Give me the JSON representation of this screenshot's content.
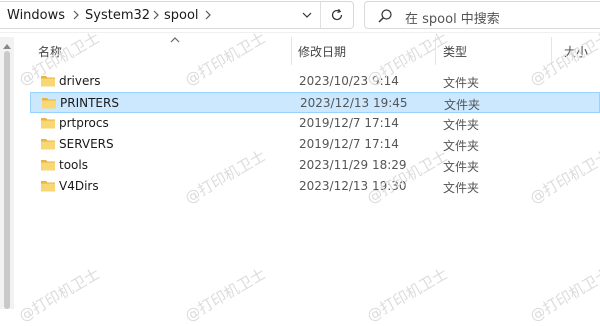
{
  "address_bar": {
    "crumbs": [
      "Windows",
      "System32",
      "spool"
    ]
  },
  "search": {
    "placeholder": "在 spool 中搜索"
  },
  "columns": {
    "name": "名称",
    "date": "修改日期",
    "type": "类型",
    "size": "大小"
  },
  "files": [
    {
      "name": "drivers",
      "date": "2023/10/23 9:14",
      "type": "文件夹",
      "selected": false
    },
    {
      "name": "PRINTERS",
      "date": "2023/12/13 19:45",
      "type": "文件夹",
      "selected": true
    },
    {
      "name": "prtprocs",
      "date": "2019/12/7 17:14",
      "type": "文件夹",
      "selected": false
    },
    {
      "name": "SERVERS",
      "date": "2019/12/7 17:14",
      "type": "文件夹",
      "selected": false
    },
    {
      "name": "tools",
      "date": "2023/11/29 18:29",
      "type": "文件夹",
      "selected": false
    },
    {
      "name": "V4Dirs",
      "date": "2023/12/13 19:30",
      "type": "文件夹",
      "selected": false
    }
  ],
  "watermark": "@打印机卫士",
  "colors": {
    "selection_bg": "#cce8ff",
    "selection_border": "#99d1ff",
    "folder": "#f5c75a"
  }
}
